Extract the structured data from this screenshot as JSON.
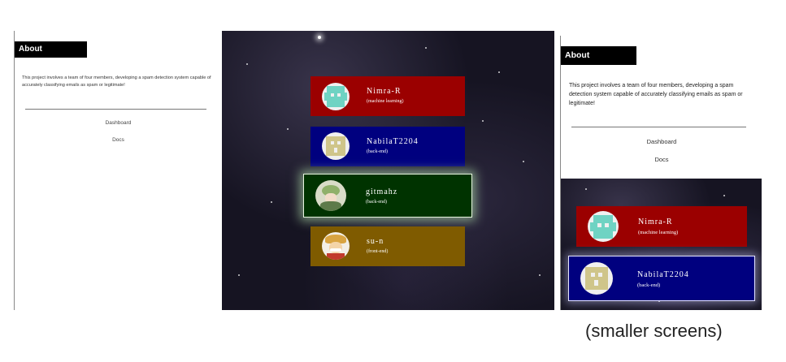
{
  "sidebar": {
    "about_title": "About",
    "about_text": "This project involves a team of four members, developing a spam detection system capable of accurately classifying emails as spam or legitimate!",
    "links": [
      {
        "label": "Dashboard"
      },
      {
        "label": "Docs"
      }
    ]
  },
  "members": [
    {
      "name": "Nimra-R",
      "role": "(machine learning)",
      "color": "#9b0000",
      "avatar": "teal-identicon"
    },
    {
      "name": "NabilaT2204",
      "role": "(back-end)",
      "color": "#00007f",
      "avatar": "khaki-identicon"
    },
    {
      "name": "gitmahz",
      "role": "(back-end)",
      "color": "#003300",
      "avatar": "anime-character-avatar"
    },
    {
      "name": "su-n",
      "role": "(front-end)",
      "color": "#7f5b00",
      "avatar": "pirate-character-avatar"
    }
  ],
  "mobile": {
    "about_title": "About",
    "about_text": "This project involves a team of four members, developing a spam detection system capable of accurately classifying emails as spam or legitimate!",
    "links": [
      {
        "label": "Dashboard"
      },
      {
        "label": "Docs"
      }
    ],
    "members": [
      {
        "name": "Nimra-R",
        "role": "(machine learning)"
      },
      {
        "name": "NabilaT2204",
        "role": "(back-end)"
      }
    ]
  },
  "caption": "(smaller screens)"
}
